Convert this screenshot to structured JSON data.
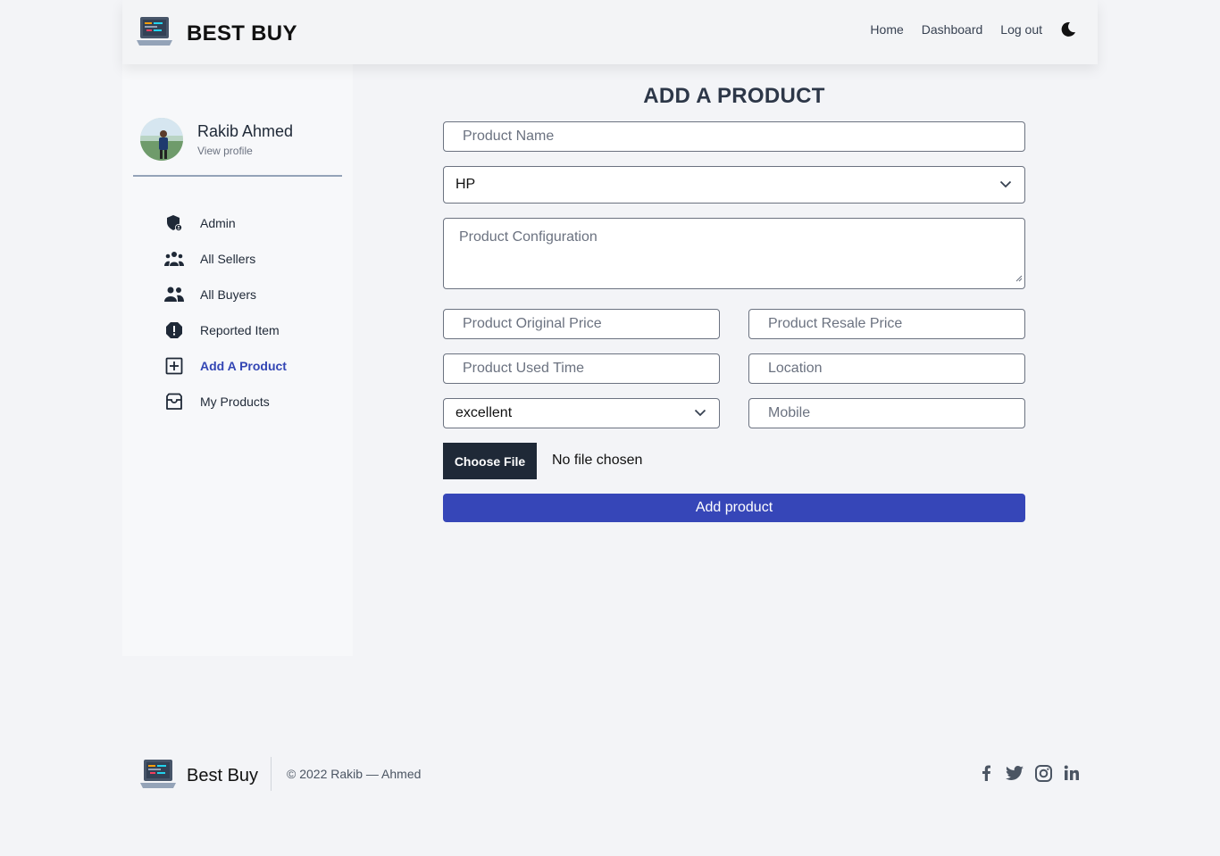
{
  "header": {
    "brand": "BEST BUY",
    "nav": [
      "Home",
      "Dashboard",
      "Log out"
    ]
  },
  "sidebar": {
    "user_name": "Rakib Ahmed",
    "profile_link": "View profile",
    "items": [
      {
        "label": "Admin",
        "icon": "shield-user-icon"
      },
      {
        "label": "All Sellers",
        "icon": "users-group-icon"
      },
      {
        "label": "All Buyers",
        "icon": "users-icon"
      },
      {
        "label": "Reported Item",
        "icon": "alert-octagon-icon"
      },
      {
        "label": "Add A Product",
        "icon": "plus-square-icon",
        "active": true
      },
      {
        "label": "My Products",
        "icon": "inbox-icon"
      }
    ]
  },
  "form": {
    "title": "ADD A PRODUCT",
    "product_name_placeholder": "Product Name",
    "brand_selected": "HP",
    "config_placeholder": "Product Configuration",
    "original_price_placeholder": "Product Original Price",
    "resale_price_placeholder": "Product Resale Price",
    "used_time_placeholder": "Product Used Time",
    "location_placeholder": "Location",
    "condition_selected": "excellent",
    "mobile_placeholder": "Mobile",
    "file_button": "Choose File",
    "file_status": "No file chosen",
    "submit": "Add product"
  },
  "footer": {
    "brand": "Best Buy",
    "copyright": "© 2022 Rakib — Ahmed",
    "social": [
      "facebook-icon",
      "twitter-icon",
      "instagram-icon",
      "linkedin-icon"
    ]
  },
  "colors": {
    "accent": "#3646b8",
    "dark_button": "#1f2937",
    "background": "#f3f4f7"
  }
}
